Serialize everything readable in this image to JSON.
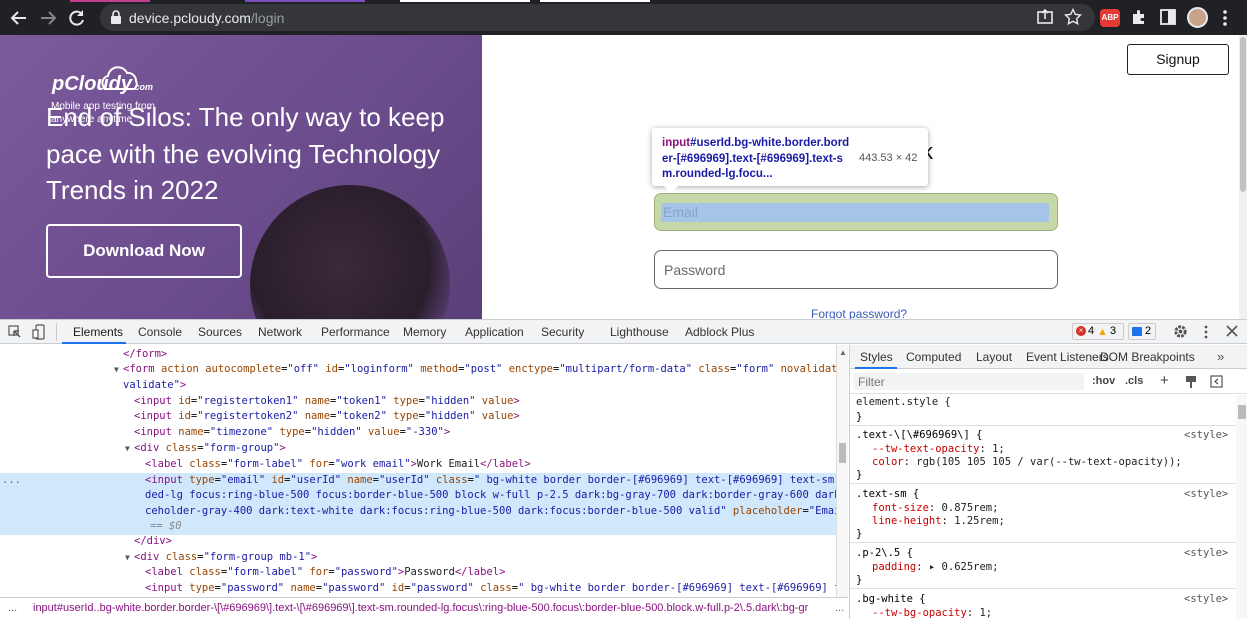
{
  "browser": {
    "url_host": "device.pcloudy.com",
    "url_path": "/login",
    "extension_badge": "ABP"
  },
  "page": {
    "logo_text": "pCloudy",
    "logo_sub": ".com",
    "tagline": "Mobile app testing from anywhere anytime",
    "headline": "End of Silos: The only way to keep pace with the evolving Technology Trends in 2022",
    "download_button": "Download Now",
    "signup_button": "Signup",
    "partial_heading": "k",
    "email_placeholder": "Email",
    "password_placeholder": "Password",
    "forgot_link": "Forgot password?"
  },
  "tooltip": {
    "selector_tag": "input",
    "selector_rest": "#userId.bg-white.border.border-[#696969].text-[#696969].text-sm.rounded-lg.focu...",
    "dimensions": "443.53 × 42"
  },
  "devtools": {
    "tabs": [
      "Elements",
      "Console",
      "Sources",
      "Network",
      "Performance",
      "Memory",
      "Application",
      "Security",
      "Lighthouse",
      "Adblock Plus"
    ],
    "active_tab": "Elements",
    "error_count": "4",
    "warning_count": "3",
    "info_count": "2",
    "styles_tabs": [
      "Styles",
      "Computed",
      "Layout",
      "Event Listeners",
      "DOM Breakpoints"
    ],
    "filter_placeholder": "Filter",
    "hov": ":hov",
    "cls": ".cls",
    "breadcrumb": "input#userId..bg-white.border.border-\\[\\#696969\\].text-\\[\\#696969\\].text-sm.rounded-lg.focus\\:ring-blue-500.focus\\:border-blue-500.block.w-full.p-2\\.5.dark\\:bg-gr",
    "more_dots": "...",
    "gutter_dots": "..."
  },
  "dom_lines": [
    {
      "html": "<span class=\"tg\">&lt;/form&gt;</span>"
    },
    {
      "html": "<span class=\"tg\">&lt;form</span> <span class=\"at\">action</span> <span class=\"at\">autocomplete</span>=<span class=\"av\">\"off\"</span> <span class=\"at\">id</span>=<span class=\"av\">\"loginform\"</span> <span class=\"at\">method</span>=<span class=\"av\">\"post\"</span> <span class=\"at\">enctype</span>=<span class=\"av\">\"multipart/form-data\"</span> <span class=\"at\">class</span>=<span class=\"av\">\"form\"</span> <span class=\"at\">novalidate</span>=<span class=\"av\">\"no</span>"
    },
    {
      "html": "<span class=\"av\">validate\"</span><span class=\"tg\">&gt;</span>"
    },
    {
      "html": "<span class=\"tg\">&lt;input</span> <span class=\"at\">id</span>=<span class=\"av\">\"registertoken1\"</span> <span class=\"at\">name</span>=<span class=\"av\">\"token1\"</span> <span class=\"at\">type</span>=<span class=\"av\">\"hidden\"</span> <span class=\"at\">value</span><span class=\"tg\">&gt;</span>"
    },
    {
      "html": "<span class=\"tg\">&lt;input</span> <span class=\"at\">id</span>=<span class=\"av\">\"registertoken2\"</span> <span class=\"at\">name</span>=<span class=\"av\">\"token2\"</span> <span class=\"at\">type</span>=<span class=\"av\">\"hidden\"</span> <span class=\"at\">value</span><span class=\"tg\">&gt;</span>"
    },
    {
      "html": "<span class=\"tg\">&lt;input</span> <span class=\"at\">name</span>=<span class=\"av\">\"timezone\"</span> <span class=\"at\">type</span>=<span class=\"av\">\"hidden\"</span> <span class=\"at\">value</span>=<span class=\"av\">\"-330\"</span><span class=\"tg\">&gt;</span>"
    },
    {
      "html": "<span class=\"tg\">&lt;div</span> <span class=\"at\">class</span>=<span class=\"av\">\"form-group\"</span><span class=\"tg\">&gt;</span>"
    },
    {
      "html": "<span class=\"tg\">&lt;label</span> <span class=\"at\">class</span>=<span class=\"av\">\"form-label\"</span> <span class=\"at\">for</span>=<span class=\"av\">\"work email\"</span><span class=\"tg\">&gt;</span><span class=\"tx\">Work Email</span><span class=\"tg\">&lt;/label&gt;</span>"
    },
    {
      "html": "<span class=\"tg\">&lt;input</span> <span class=\"at\">type</span>=<span class=\"av\">\"email\"</span> <span class=\"at\">id</span>=<span class=\"av\">\"userId\"</span> <span class=\"at\">name</span>=<span class=\"av\">\"userId\"</span> <span class=\"at\">class</span>=<span class=\"av\">\" bg-white border border-[#696969] text-[#696969] text-sm roun</span>"
    },
    {
      "html": "<span class=\"av\">ded-lg focus:ring-blue-500 focus:border-blue-500 block w-full p-2.5 dark:bg-gray-700 dark:border-gray-600 dark:pla</span>"
    },
    {
      "html": "<span class=\"av\">ceholder-gray-400 dark:text-white dark:focus:ring-blue-500 dark:focus:border-blue-500 valid\"</span> <span class=\"at\">placeholder</span>=<span class=\"av\">\"Email\"</span><span class=\"tg\">&gt;</span>"
    },
    {
      "html": "<span class=\"dim\">== $0</span>"
    },
    {
      "html": "<span class=\"tg\">&lt;/div&gt;</span>"
    },
    {
      "html": "<span class=\"tg\">&lt;div</span> <span class=\"at\">class</span>=<span class=\"av\">\"form-group mb-1\"</span><span class=\"tg\">&gt;</span>"
    },
    {
      "html": "<span class=\"tg\">&lt;label</span> <span class=\"at\">class</span>=<span class=\"av\">\"form-label\"</span> <span class=\"at\">for</span>=<span class=\"av\">\"password\"</span><span class=\"tg\">&gt;</span><span class=\"tx\">Password</span><span class=\"tg\">&lt;/label&gt;</span>"
    },
    {
      "html": "<span class=\"tg\">&lt;input</span> <span class=\"at\">type</span>=<span class=\"av\">\"password\"</span> <span class=\"at\">name</span>=<span class=\"av\">\"password\"</span> <span class=\"at\">id</span>=<span class=\"av\">\"password\"</span> <span class=\"at\">class</span>=<span class=\"av\">\" bg-white border border-[#696969] text-[#696969] text-</span>"
    }
  ],
  "styles": {
    "element_style": "element.style {",
    "close_brace": "}",
    "rules": [
      {
        "selector": ".text-\\[\\#696969\\] {",
        "source": "<style>",
        "props": [
          [
            "--tw-text-opacity",
            "1;"
          ],
          [
            "color",
            "rgb(105 105 105 / var(--tw-text-opacity));"
          ]
        ]
      },
      {
        "selector": ".text-sm {",
        "source": "<style>",
        "props": [
          [
            "font-size",
            "0.875rem;"
          ],
          [
            "line-height",
            "1.25rem;"
          ]
        ]
      },
      {
        "selector": ".p-2\\.5 {",
        "source": "<style>",
        "props": [
          [
            "padding",
            "▸ 0.625rem;"
          ]
        ]
      },
      {
        "selector": ".bg-white {",
        "source": "<style>",
        "props": [
          [
            "--tw-bg-opacity",
            "1;"
          ]
        ]
      }
    ]
  },
  "colors": {
    "hero_purple": "#6a4b8c",
    "devtools_selected": "#cfe8fc",
    "autofill_green": "#c5d9a8"
  }
}
